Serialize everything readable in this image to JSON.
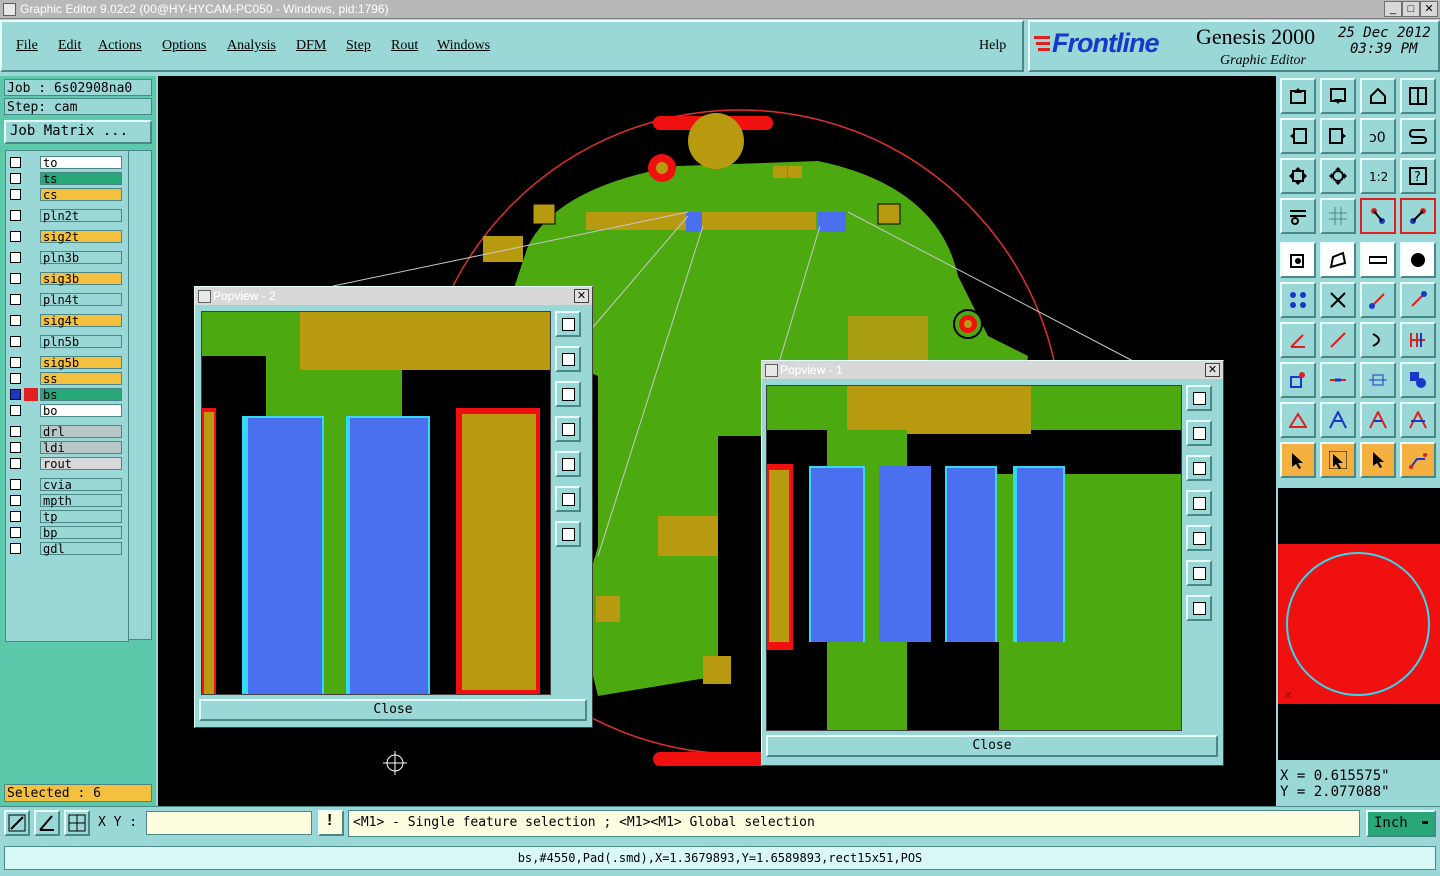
{
  "window": {
    "title": "Graphic Editor 9.02c2 (00@HY-HYCAM-PC050 - Windows, pid:1796)",
    "minimize": "_",
    "maximize": "□",
    "close": "✕"
  },
  "menu": [
    "File",
    "Edit",
    "Actions",
    "Options",
    "Analysis",
    "DFM",
    "Step",
    "Rout",
    "Windows"
  ],
  "help": "Help",
  "brand": {
    "logo": "Frontline",
    "product": "Genesis 2000",
    "subtitle": "Graphic Editor",
    "date": "25 Dec 2012",
    "time": "03:39 PM"
  },
  "job": {
    "job_label": "Job : 6s02908na0",
    "step_label": "Step: cam",
    "matrix_button": "Job Matrix ..."
  },
  "layers": [
    {
      "name": "to",
      "color": "#ffffff"
    },
    {
      "name": "ts",
      "color": "#28a878"
    },
    {
      "name": "cs",
      "color": "#f4c040"
    },
    {
      "name": "pln2t",
      "color": "#9ad8d8"
    },
    {
      "name": "sig2t",
      "color": "#f4c040"
    },
    {
      "name": "pln3b",
      "color": "#9ad8d8"
    },
    {
      "name": "sig3b",
      "color": "#f4c040"
    },
    {
      "name": "pln4t",
      "color": "#9ad8d8"
    },
    {
      "name": "sig4t",
      "color": "#f4c040"
    },
    {
      "name": "pln5b",
      "color": "#9ad8d8"
    },
    {
      "name": "sig5b",
      "color": "#f4c040"
    },
    {
      "name": "ss",
      "color": "#f4c040"
    },
    {
      "name": "bs",
      "color": "#28a878"
    },
    {
      "name": "bo",
      "color": "#ffffff"
    },
    {
      "name": "drl",
      "color": "#b8c8c8"
    },
    {
      "name": "ldi",
      "color": "#b8c8c8"
    },
    {
      "name": "rout",
      "color": "#d8d8d8"
    },
    {
      "name": "cvia",
      "color": "#9ad8d8"
    },
    {
      "name": "mpth",
      "color": "#9ad8d8"
    },
    {
      "name": "tp",
      "color": "#9ad8d8"
    },
    {
      "name": "bp",
      "color": "#9ad8d8"
    },
    {
      "name": "gdl",
      "color": "#9ad8d8"
    }
  ],
  "selected_label": "Selected : 6",
  "popview2": {
    "title": "Popview - 2",
    "close": "Close"
  },
  "popview1": {
    "title": "Popview - 1",
    "close": "Close"
  },
  "coords": {
    "x": "X = 0.615575\"",
    "y": "Y = 2.077088\""
  },
  "xy_label": "X Y :",
  "xy_value": "",
  "hint": "<M1> - Single feature selection ; <M1><M1> Global selection",
  "units": "Inch",
  "status": "bs,#4550,Pad(.smd),X=1.3679893,Y=1.6589893,rect15x51,POS",
  "colors": {
    "board_green": "#4caa10",
    "copper": "#b89a10",
    "pad_blue": "#4a70f0",
    "red": "#f01010",
    "ui_cyan": "#9ad8d8",
    "panel_green": "#5ccaaa"
  }
}
